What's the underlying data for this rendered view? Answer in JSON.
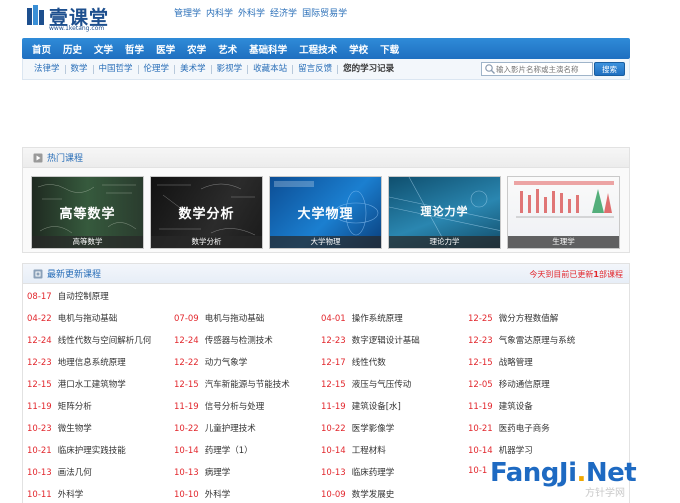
{
  "header": {
    "logo_text": "壹课堂",
    "logo_sub": "www.1ketang.com",
    "top_links": [
      "管理学",
      "内科学",
      "外科学",
      "经济学",
      "国际贸易学"
    ]
  },
  "main_nav": [
    "首页",
    "历史",
    "文学",
    "哲学",
    "医学",
    "农学",
    "艺术",
    "基础科学",
    "工程技术",
    "学校",
    "下载"
  ],
  "sub_nav": [
    "法律学",
    "数学",
    "中国哲学",
    "伦理学",
    "美术学",
    "影视学",
    "收藏本站",
    "留言反馈"
  ],
  "sub_nav_bold": "您的学习记录",
  "search": {
    "placeholder": "输入影片名称或主演名称",
    "button": "搜索"
  },
  "hot": {
    "title": "热门课程",
    "items": [
      {
        "title": "高等数学",
        "caption": "高等数学"
      },
      {
        "title": "数学分析",
        "caption": "数学分析"
      },
      {
        "title": "大学物理",
        "caption": "大学物理"
      },
      {
        "title": "理论力学",
        "caption": "理论力学"
      },
      {
        "title": "",
        "caption": "生理学"
      }
    ]
  },
  "latest": {
    "title": "最新更新课程",
    "note_prefix": "今天到目前已更新",
    "note_count": "1",
    "note_suffix": "部课程",
    "first": {
      "date": "08-17",
      "title": "自动控制原理"
    },
    "rows": [
      [
        {
          "date": "04-22",
          "title": "电机与拖动基础"
        },
        {
          "date": "07-09",
          "title": "电机与拖动基础"
        },
        {
          "date": "04-01",
          "title": "操作系统原理"
        },
        {
          "date": "12-25",
          "title": "微分方程数值解"
        }
      ],
      [
        {
          "date": "12-24",
          "title": "线性代数与空间解析几何"
        },
        {
          "date": "12-24",
          "title": "传感器与检测技术"
        },
        {
          "date": "12-23",
          "title": "数字逻辑设计基础"
        },
        {
          "date": "12-23",
          "title": "气象雷达原理与系统"
        }
      ],
      [
        {
          "date": "12-23",
          "title": "地理信息系统原理"
        },
        {
          "date": "12-22",
          "title": "动力气象学"
        },
        {
          "date": "12-17",
          "title": "线性代数"
        },
        {
          "date": "12-15",
          "title": "战略管理"
        }
      ],
      [
        {
          "date": "12-15",
          "title": "港口水工建筑物学"
        },
        {
          "date": "12-15",
          "title": "汽车新能源与节能技术"
        },
        {
          "date": "12-15",
          "title": "液压与气压传动"
        },
        {
          "date": "12-05",
          "title": "移动通信原理"
        }
      ],
      [
        {
          "date": "11-19",
          "title": "矩阵分析"
        },
        {
          "date": "11-19",
          "title": "信号分析与处理"
        },
        {
          "date": "11-19",
          "title": "建筑设备[水]"
        },
        {
          "date": "11-19",
          "title": "建筑设备"
        }
      ],
      [
        {
          "date": "10-23",
          "title": "微生物学"
        },
        {
          "date": "10-22",
          "title": "儿童护理技术"
        },
        {
          "date": "10-22",
          "title": "医学影像学"
        },
        {
          "date": "10-21",
          "title": "医药电子商务"
        }
      ],
      [
        {
          "date": "10-21",
          "title": "临床护理实践技能"
        },
        {
          "date": "10-14",
          "title": "药理学（1）"
        },
        {
          "date": "10-14",
          "title": "工程材料"
        },
        {
          "date": "10-14",
          "title": "机器学习"
        }
      ],
      [
        {
          "date": "10-13",
          "title": "画法几何"
        },
        {
          "date": "10-13",
          "title": "病理学"
        },
        {
          "date": "10-13",
          "title": "临床药理学"
        },
        {
          "date": "10-1",
          "title": ""
        }
      ],
      [
        {
          "date": "10-11",
          "title": "外科学"
        },
        {
          "date": "10-10",
          "title": "外科学"
        },
        {
          "date": "10-09",
          "title": "数学发展史"
        },
        {
          "date": "",
          "title": ""
        }
      ]
    ]
  },
  "watermark": {
    "text_a": "FangJi",
    "dot": ".",
    "text_b": "Net",
    "sub": "方针学网"
  },
  "colors": {
    "accent": "#1f6fc0",
    "date_red": "#e2272d",
    "link_blue": "#2a6fb8"
  }
}
